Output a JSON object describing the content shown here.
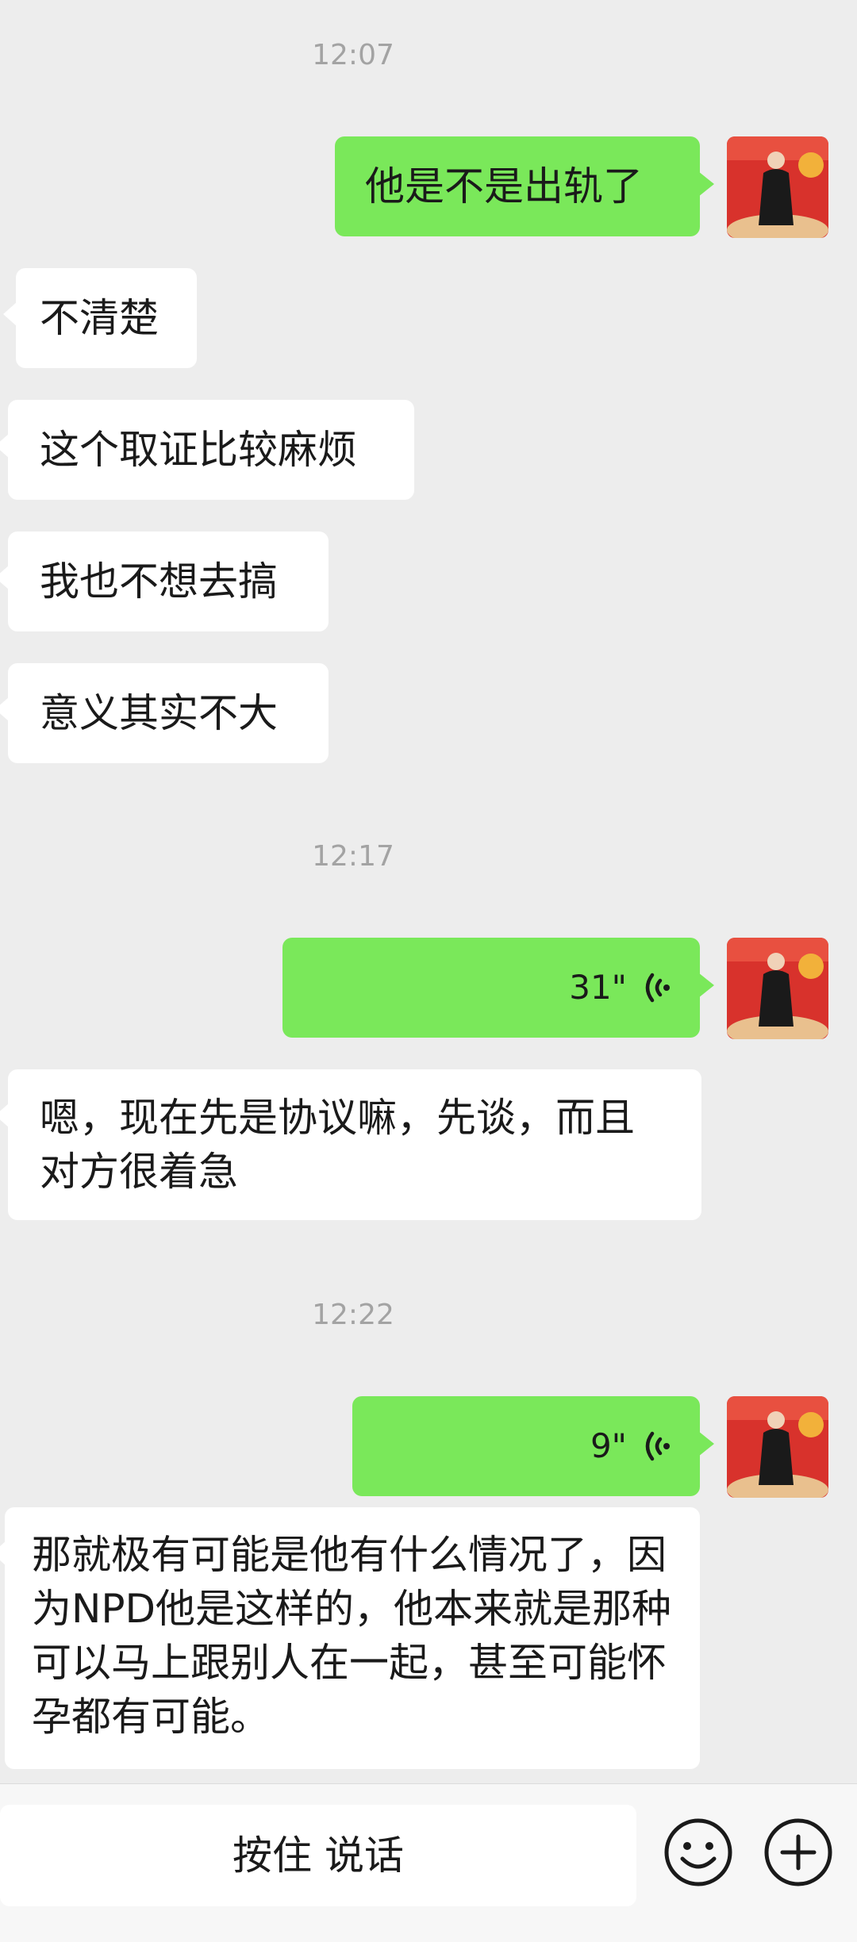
{
  "chat": {
    "timestamps": [
      "12:07",
      "12:17",
      "12:22"
    ],
    "messages": [
      {
        "text": "他是不是出轨了"
      },
      {
        "text": "不清楚"
      },
      {
        "text": "这个取证比较麻烦"
      },
      {
        "text": "我也不想去搞"
      },
      {
        "text": "意义其实不大"
      },
      {
        "duration": "31\""
      },
      {
        "text": "嗯，现在先是协议嘛，先谈，而且对方很着急"
      },
      {
        "duration": "9\""
      },
      {
        "text": "那就极有可能是他有什么情况了，因为NPD他是这样的，他本来就是那种可以马上跟别人在一起，甚至可能怀孕都有可能。"
      }
    ]
  },
  "input_bar": {
    "hold_to_talk_label": "按住 说话",
    "emoji_icon": "emoji-icon",
    "plus_icon": "plus-icon"
  },
  "colors": {
    "outgoing_bubble": "#7ae85a",
    "incoming_bubble": "#ffffff",
    "background": "#ededed"
  }
}
